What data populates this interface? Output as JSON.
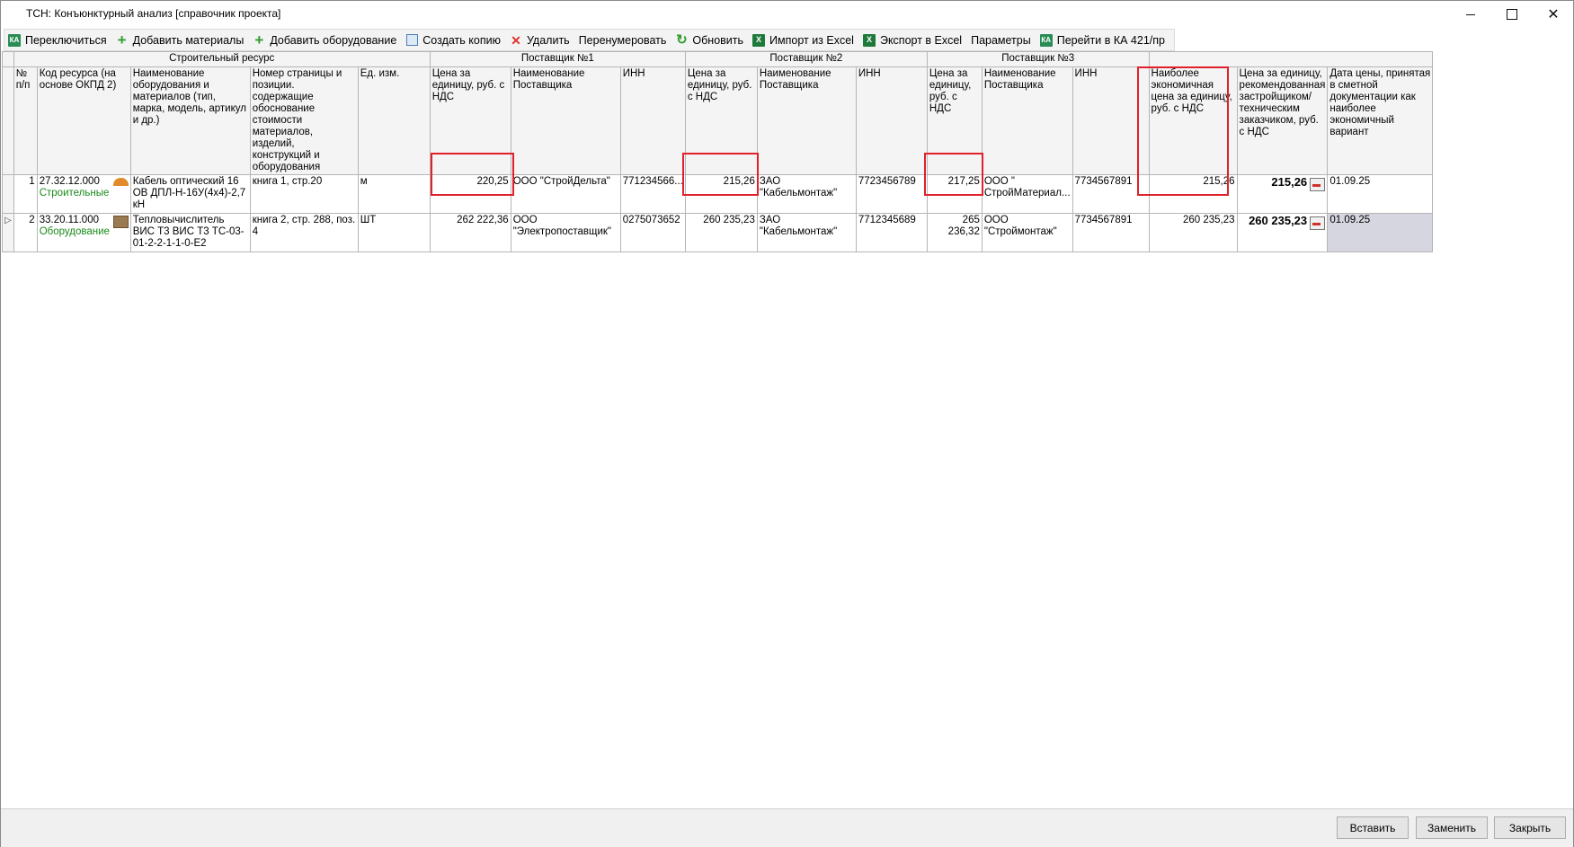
{
  "window": {
    "title": "ТСН: Конъюнктурный анализ [справочник проекта]"
  },
  "toolbar": {
    "switch": "Переключиться",
    "add_materials": "Добавить материалы",
    "add_equipment": "Добавить оборудование",
    "create_copy": "Создать копию",
    "delete": "Удалить",
    "renumber": "Перенумеровать",
    "refresh": "Обновить",
    "import_excel": "Импорт из Excel",
    "export_excel": "Экспорт в Excel",
    "parameters": "Параметры",
    "goto_ka": "Перейти в КА 421/пр"
  },
  "groups": {
    "resource": "Строительный ресурс",
    "supplier1": "Поставщик №1",
    "supplier2": "Поставщик №2",
    "supplier3": "Поставщик №3"
  },
  "headers": {
    "num": "№ п/п",
    "code": "Код ресурса (на основе ОКПД 2)",
    "name": "Наименование оборудования и материалов (тип, марка, модель, артикул и др.)",
    "page": "Номер страницы и позиции. содержащие обоснование стоимости материалов, изделий, конструкций и оборудования",
    "unit": "Ед. изм.",
    "s1_price": "Цена за единицу, руб. с НДС",
    "s1_name": "Наименование Поставщика",
    "s1_inn": "ИНН",
    "s2_price": "Цена за единицу, руб. с НДС",
    "s2_name": "Наименование Поставщика",
    "s2_inn": "ИНН",
    "s3_price": "Цена за единицу, руб. с НДС",
    "s3_name": "Наименование Поставщика",
    "s3_inn": "ИНН",
    "best_price": "Наиболее экономичная цена за единицу, руб. с НДС",
    "rec_price": "Цена за единицу, рекомендованная застройщиком/ техническим заказчиком, руб. с НДС",
    "date": "Дата цены, принятая в сметной документации как наиболее экономичный вариант"
  },
  "rows": [
    {
      "num": "1",
      "code": "27.32.12.000",
      "category": "Строительные",
      "name": "Кабель оптический 16 ОВ ДПЛ-Н-16У(4х4)-2,7 кН",
      "page": "книга 1, стр.20",
      "unit": "м",
      "s1_price": "220,25",
      "s1_name": "ООО \"СтройДельта\"",
      "s1_inn": "771234566...",
      "s2_price": "215,26",
      "s2_name": "ЗАО \"Кабельмонтаж\"",
      "s2_inn": "7723456789",
      "s3_price": "217,25",
      "s3_name": "ООО \" СтройМатериал...",
      "s3_inn": "7734567891",
      "best_price": "215,26",
      "rec_price": "215,26",
      "date": "01.09.25"
    },
    {
      "num": "2",
      "code": "33.20.11.000",
      "category": "Оборудование",
      "name": "Тепловычислитель ВИС Т3 ВИС Т3 ТС-03-01-2-2-1-1-0-Е2",
      "page": "книга 2, стр. 288, поз. 4",
      "unit": "ШТ",
      "s1_price": "262 222,36",
      "s1_name": "ООО \"Электропоставщик\"",
      "s1_inn": "0275073652",
      "s2_price": "260 235,23",
      "s2_name": "ЗАО \"Кабельмонтаж\"",
      "s2_inn": "7712345689",
      "s3_price": "265 236,32",
      "s3_name": "ООО \"Строймонтаж\"",
      "s3_inn": "7734567891",
      "best_price": "260 235,23",
      "rec_price": "260 235,23",
      "date": "01.09.25"
    }
  ],
  "buttons": {
    "insert": "Вставить",
    "replace": "Заменить",
    "close": "Закрыть"
  },
  "colors": {
    "highlight": "#e0202a",
    "category_text": "#1a8a1a",
    "selected_cell": "#d6d6e0"
  }
}
